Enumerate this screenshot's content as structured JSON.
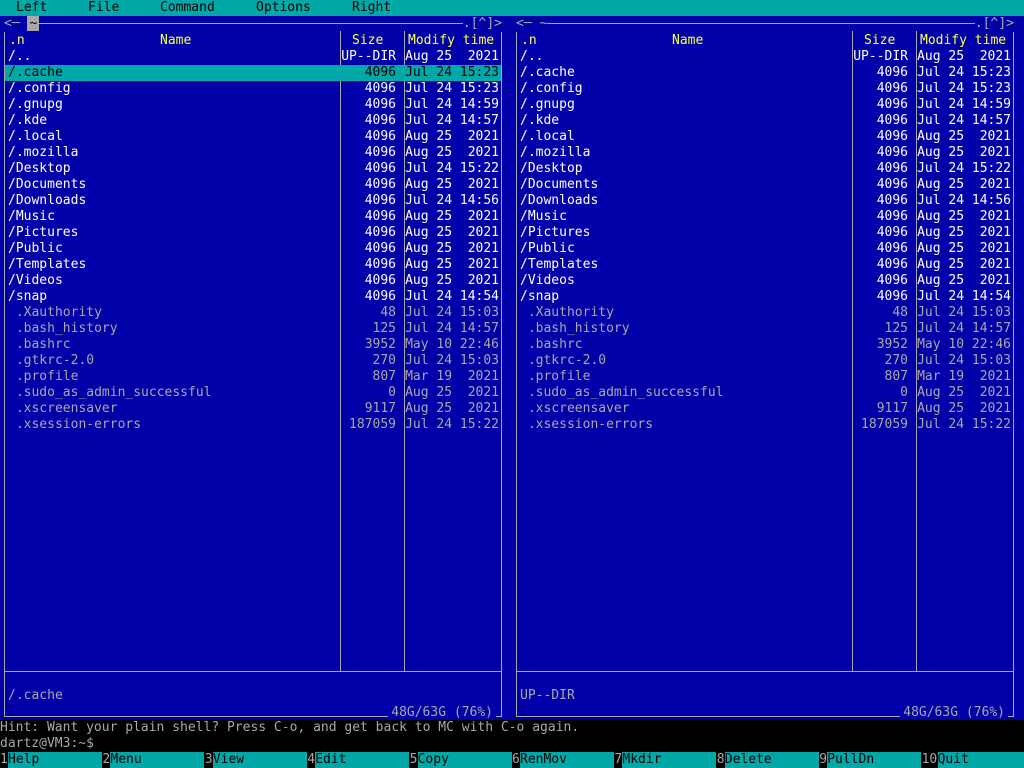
{
  "menu": [
    "Left",
    "File",
    "Command",
    "Options",
    "Right"
  ],
  "left_panel": {
    "path": "~",
    "corner": ".[^]>",
    "cols": {
      "name_flag": ".n",
      "name": "Name",
      "size": "Size",
      "mtime": "Modify time"
    },
    "rows": [
      {
        "name": "/..",
        "size": "UP--DIR",
        "mtime": "Aug 25  2021",
        "kind": "dir"
      },
      {
        "name": "/.cache",
        "size": "4096",
        "mtime": "Jul 24 15:23",
        "kind": "dir",
        "selected": true
      },
      {
        "name": "/.config",
        "size": "4096",
        "mtime": "Jul 24 15:23",
        "kind": "dir"
      },
      {
        "name": "/.gnupg",
        "size": "4096",
        "mtime": "Jul 24 14:59",
        "kind": "dir"
      },
      {
        "name": "/.kde",
        "size": "4096",
        "mtime": "Jul 24 14:57",
        "kind": "dir"
      },
      {
        "name": "/.local",
        "size": "4096",
        "mtime": "Aug 25  2021",
        "kind": "dir"
      },
      {
        "name": "/.mozilla",
        "size": "4096",
        "mtime": "Aug 25  2021",
        "kind": "dir"
      },
      {
        "name": "/Desktop",
        "size": "4096",
        "mtime": "Jul 24 15:22",
        "kind": "dir"
      },
      {
        "name": "/Documents",
        "size": "4096",
        "mtime": "Aug 25  2021",
        "kind": "dir"
      },
      {
        "name": "/Downloads",
        "size": "4096",
        "mtime": "Jul 24 14:56",
        "kind": "dir"
      },
      {
        "name": "/Music",
        "size": "4096",
        "mtime": "Aug 25  2021",
        "kind": "dir"
      },
      {
        "name": "/Pictures",
        "size": "4096",
        "mtime": "Aug 25  2021",
        "kind": "dir"
      },
      {
        "name": "/Public",
        "size": "4096",
        "mtime": "Aug 25  2021",
        "kind": "dir"
      },
      {
        "name": "/Templates",
        "size": "4096",
        "mtime": "Aug 25  2021",
        "kind": "dir"
      },
      {
        "name": "/Videos",
        "size": "4096",
        "mtime": "Aug 25  2021",
        "kind": "dir"
      },
      {
        "name": "/snap",
        "size": "4096",
        "mtime": "Jul 24 14:54",
        "kind": "dir"
      },
      {
        "name": " .Xauthority",
        "size": "48",
        "mtime": "Jul 24 15:03",
        "kind": "file"
      },
      {
        "name": " .bash_history",
        "size": "125",
        "mtime": "Jul 24 14:57",
        "kind": "file"
      },
      {
        "name": " .bashrc",
        "size": "3952",
        "mtime": "May 10 22:46",
        "kind": "file"
      },
      {
        "name": " .gtkrc-2.0",
        "size": "270",
        "mtime": "Jul 24 15:03",
        "kind": "file"
      },
      {
        "name": " .profile",
        "size": "807",
        "mtime": "Mar 19  2021",
        "kind": "file"
      },
      {
        "name": " .sudo_as_admin_successful",
        "size": "0",
        "mtime": "Aug 25  2021",
        "kind": "file"
      },
      {
        "name": " .xscreensaver",
        "size": "9117",
        "mtime": "Aug 25  2021",
        "kind": "file"
      },
      {
        "name": " .xsession-errors",
        "size": "187059",
        "mtime": "Jul 24 15:22",
        "kind": "file"
      }
    ],
    "mini_status": "/.cache",
    "free": "48G/63G (76%)"
  },
  "right_panel": {
    "path": "~",
    "corner": ".[^]>",
    "cols": {
      "name_flag": ".n",
      "name": "Name",
      "size": "Size",
      "mtime": "Modify time"
    },
    "rows": [
      {
        "name": "/..",
        "size": "UP--DIR",
        "mtime": "Aug 25  2021",
        "kind": "dir"
      },
      {
        "name": "/.cache",
        "size": "4096",
        "mtime": "Jul 24 15:23",
        "kind": "dir"
      },
      {
        "name": "/.config",
        "size": "4096",
        "mtime": "Jul 24 15:23",
        "kind": "dir"
      },
      {
        "name": "/.gnupg",
        "size": "4096",
        "mtime": "Jul 24 14:59",
        "kind": "dir"
      },
      {
        "name": "/.kde",
        "size": "4096",
        "mtime": "Jul 24 14:57",
        "kind": "dir"
      },
      {
        "name": "/.local",
        "size": "4096",
        "mtime": "Aug 25  2021",
        "kind": "dir"
      },
      {
        "name": "/.mozilla",
        "size": "4096",
        "mtime": "Aug 25  2021",
        "kind": "dir"
      },
      {
        "name": "/Desktop",
        "size": "4096",
        "mtime": "Jul 24 15:22",
        "kind": "dir"
      },
      {
        "name": "/Documents",
        "size": "4096",
        "mtime": "Aug 25  2021",
        "kind": "dir"
      },
      {
        "name": "/Downloads",
        "size": "4096",
        "mtime": "Jul 24 14:56",
        "kind": "dir"
      },
      {
        "name": "/Music",
        "size": "4096",
        "mtime": "Aug 25  2021",
        "kind": "dir"
      },
      {
        "name": "/Pictures",
        "size": "4096",
        "mtime": "Aug 25  2021",
        "kind": "dir"
      },
      {
        "name": "/Public",
        "size": "4096",
        "mtime": "Aug 25  2021",
        "kind": "dir"
      },
      {
        "name": "/Templates",
        "size": "4096",
        "mtime": "Aug 25  2021",
        "kind": "dir"
      },
      {
        "name": "/Videos",
        "size": "4096",
        "mtime": "Aug 25  2021",
        "kind": "dir"
      },
      {
        "name": "/snap",
        "size": "4096",
        "mtime": "Jul 24 14:54",
        "kind": "dir"
      },
      {
        "name": " .Xauthority",
        "size": "48",
        "mtime": "Jul 24 15:03",
        "kind": "file"
      },
      {
        "name": " .bash_history",
        "size": "125",
        "mtime": "Jul 24 14:57",
        "kind": "file"
      },
      {
        "name": " .bashrc",
        "size": "3952",
        "mtime": "May 10 22:46",
        "kind": "file"
      },
      {
        "name": " .gtkrc-2.0",
        "size": "270",
        "mtime": "Jul 24 15:03",
        "kind": "file"
      },
      {
        "name": " .profile",
        "size": "807",
        "mtime": "Mar 19  2021",
        "kind": "file"
      },
      {
        "name": " .sudo_as_admin_successful",
        "size": "0",
        "mtime": "Aug 25  2021",
        "kind": "file"
      },
      {
        "name": " .xscreensaver",
        "size": "9117",
        "mtime": "Aug 25  2021",
        "kind": "file"
      },
      {
        "name": " .xsession-errors",
        "size": "187059",
        "mtime": "Jul 24 15:22",
        "kind": "file"
      }
    ],
    "mini_status": "UP--DIR",
    "free": "48G/63G (76%)"
  },
  "hint": "Hint: Want your plain shell? Press C-o, and get back to MC with C-o again.",
  "prompt": "dartz@VM3:~$",
  "fkeys": [
    {
      "num": "1",
      "label": "Help"
    },
    {
      "num": "2",
      "label": "Menu"
    },
    {
      "num": "3",
      "label": "View"
    },
    {
      "num": "4",
      "label": "Edit"
    },
    {
      "num": "5",
      "label": "Copy"
    },
    {
      "num": "6",
      "label": "RenMov"
    },
    {
      "num": "7",
      "label": "Mkdir"
    },
    {
      "num": "8",
      "label": "Delete"
    },
    {
      "num": "9",
      "label": "PullDn"
    },
    {
      "num": "10",
      "label": "Quit"
    }
  ],
  "colors": {
    "panel_bg": "#0000a8",
    "cyan": "#00a8a8",
    "dir_fg": "#ffffff",
    "file_fg": "#a8a8a8",
    "header_fg": "#ffff54"
  }
}
